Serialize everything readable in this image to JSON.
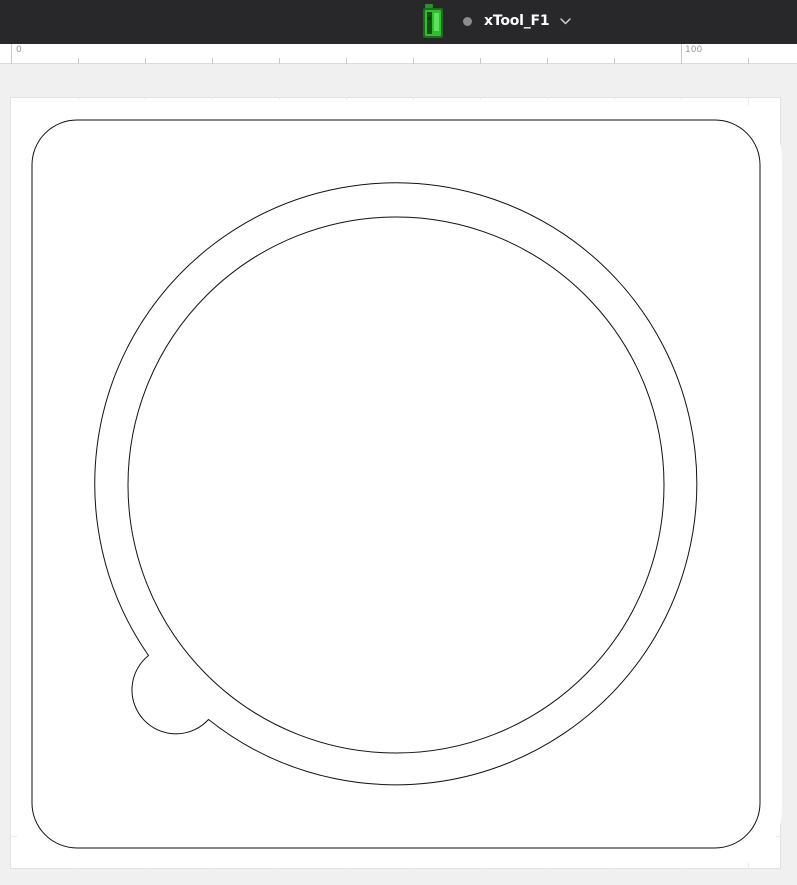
{
  "header": {
    "device_name": "xTool_F1",
    "device_icon": "green-laser-machine-icon",
    "status_color": "#8c8c8c",
    "dropdown_icon": "chevron-down-icon"
  },
  "ruler": {
    "labels": [
      "0",
      "100"
    ]
  },
  "canvas": {
    "grid": true,
    "shapes": [
      "rounded-square-outline",
      "outer-circle-with-tab",
      "inner-circle"
    ]
  }
}
